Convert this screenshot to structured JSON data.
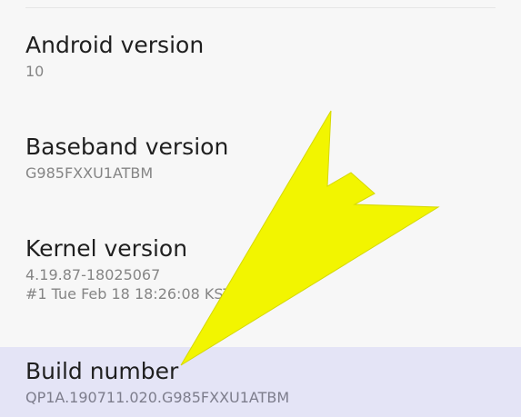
{
  "settings": {
    "items": [
      {
        "title": "Android version",
        "summary": "10"
      },
      {
        "title": "Baseband version",
        "summary": "G985FXXU1ATBM"
      },
      {
        "title": "Kernel version",
        "summary": "4.19.87-18025067\n#1 Tue Feb 18 18:26:08 KST 2020"
      },
      {
        "title": "Build number",
        "summary": "QP1A.190711.020.G985FXXU1ATBM"
      }
    ],
    "highlighted_item": "Build number"
  },
  "overlay": {
    "arrow_color": "#f2f500",
    "highlight_color": "#e4e4f6"
  }
}
